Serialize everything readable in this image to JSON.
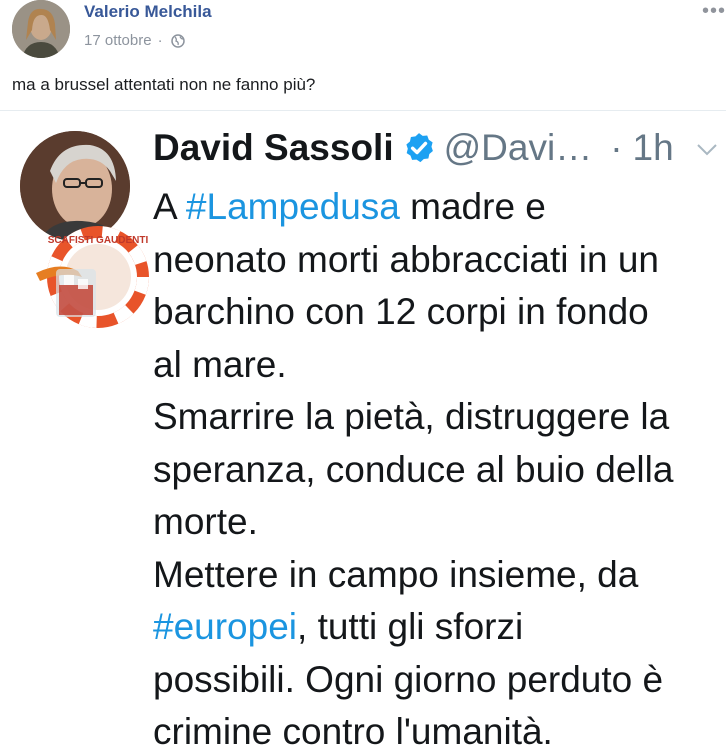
{
  "post": {
    "author": "Valerio Melchila",
    "date": "17 ottobre",
    "separator": "·",
    "more": "•••",
    "text": "ma a brussel attentati non ne fanno più?"
  },
  "tweet": {
    "name": "David Sassoli",
    "handle": "@Davi…",
    "dot": "·",
    "time": "1h",
    "lines": [
      {
        "pre": "A ",
        "tag": "#Lampedusa",
        "post": " madre e"
      },
      {
        "pre": "neonato morti abbracciati in un",
        "tag": "",
        "post": ""
      },
      {
        "pre": "barchino con 12 corpi in fondo",
        "tag": "",
        "post": ""
      },
      {
        "pre": "al mare.",
        "tag": "",
        "post": ""
      },
      {
        "pre": "Smarrire la pietà, distruggere la",
        "tag": "",
        "post": ""
      },
      {
        "pre": "speranza, conduce al buio della",
        "tag": "",
        "post": ""
      },
      {
        "pre": "morte.",
        "tag": "",
        "post": ""
      },
      {
        "pre": "Mettere in campo insieme, da",
        "tag": "",
        "post": ""
      },
      {
        "pre": "",
        "tag": "#europei",
        "post": ", tutti gli sforzi"
      },
      {
        "pre": "possibili. Ogni giorno perduto è",
        "tag": "",
        "post": ""
      },
      {
        "pre": "crimine contro l'umanità.",
        "tag": "",
        "post": ""
      }
    ]
  },
  "sticker_text": "SCAFISTI GAUDENTI",
  "colors": {
    "fb_link": "#385898",
    "hashtag": "#1b95e0",
    "verified": "#1da1f2"
  }
}
